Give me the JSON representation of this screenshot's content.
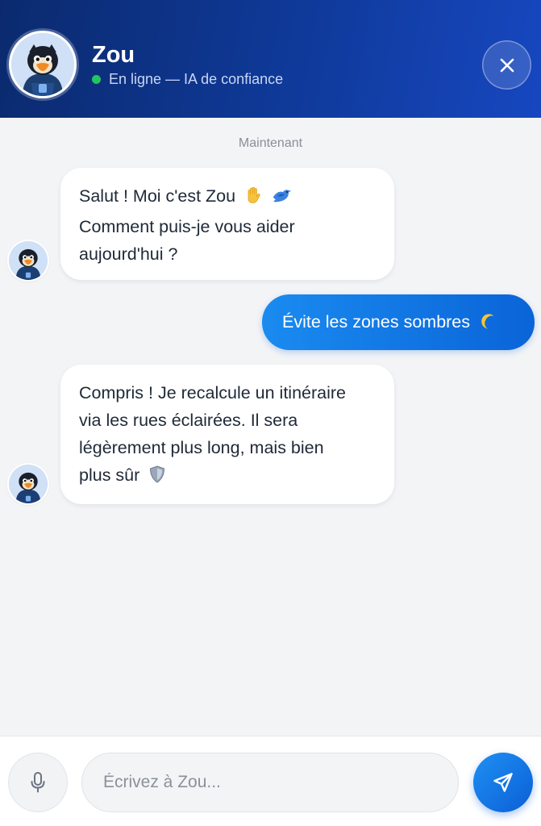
{
  "header": {
    "title": "Zou",
    "status_text": "En ligne — IA de confiance",
    "status_color": "#22c55e",
    "avatar_icon": "penguin-mascot-icon",
    "close_icon": "close-icon"
  },
  "chat": {
    "timestamp": "Maintenant",
    "messages": [
      {
        "sender": "bot",
        "lines": [
          "Salut ! Moi c'est Zou",
          "Comment puis-je vous aider",
          "aujourd'hui ?"
        ],
        "emojis": [
          "✋",
          "🐦"
        ]
      },
      {
        "sender": "user",
        "text": "Évite les zones sombres",
        "emoji": "🌙"
      },
      {
        "sender": "bot",
        "lines": [
          "Compris ! Je recalcule un itinéraire",
          "via les rues éclairées. Il sera",
          "légèrement plus long, mais bien",
          "plus sûr"
        ],
        "emoji": "🛡️"
      }
    ]
  },
  "input": {
    "placeholder": "Écrivez à Zou...",
    "value": "",
    "mic_icon": "microphone-icon",
    "send_icon": "send-icon"
  },
  "colors": {
    "header_start": "#0b2a6e",
    "header_end": "#1747c0",
    "user_bubble": "#1a8bf0",
    "send_button": "#0b5fd6",
    "background": "#f3f4f6"
  }
}
